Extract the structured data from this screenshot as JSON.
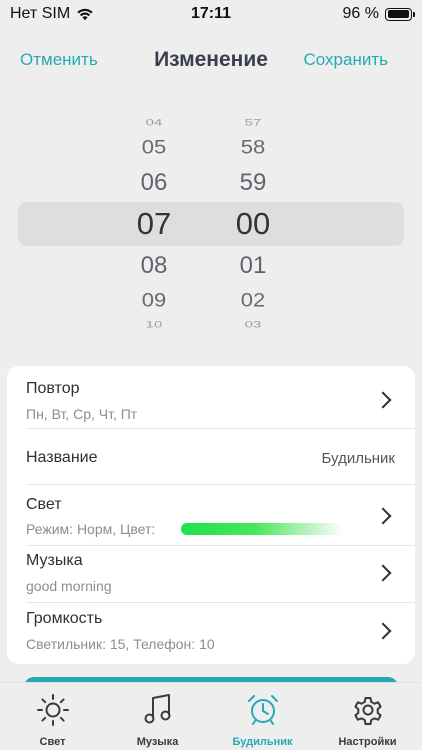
{
  "status_bar": {
    "carrier": "Нет SIM",
    "time": "17:11",
    "battery": "96 %",
    "battery_level": 0.96
  },
  "header": {
    "cancel_label": "Отменить",
    "title": "Изменение",
    "save_label": "Сохранить"
  },
  "picker": {
    "hours": [
      "04",
      "05",
      "06",
      "07",
      "08",
      "09",
      "10"
    ],
    "minutes": [
      "57",
      "58",
      "59",
      "00",
      "01",
      "02",
      "03"
    ],
    "selected_hour": "07",
    "selected_minute": "00"
  },
  "settings": {
    "repeat": {
      "title": "Повтор",
      "value": "Пн, Вт, Ср, Чт, Пт"
    },
    "name": {
      "title": "Название",
      "value": "Будильник"
    },
    "light": {
      "title": "Свет",
      "value": "Режим: Норм, Цвет:"
    },
    "music": {
      "title": "Музыка",
      "value": "good morning"
    },
    "volume": {
      "title": "Громкость",
      "value": "Светильник: 15, Телефон: 10"
    }
  },
  "tabs": [
    {
      "label": "Свет",
      "icon": "sun-icon"
    },
    {
      "label": "Музыка",
      "icon": "music-note-icon"
    },
    {
      "label": "Будильник",
      "icon": "alarm-clock-icon"
    },
    {
      "label": "Настройки",
      "icon": "gear-icon"
    }
  ],
  "colors": {
    "accent": "#25aab5",
    "light_color_start": "#1ee04a",
    "background": "#efeeee"
  }
}
